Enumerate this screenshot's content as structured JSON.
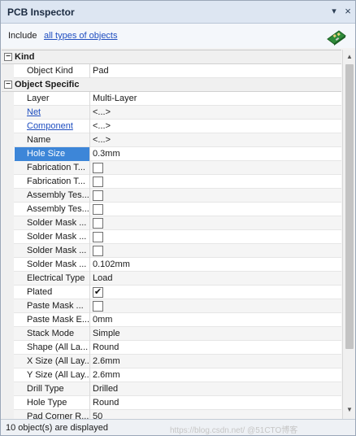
{
  "window": {
    "title": "PCB Inspector",
    "pin_glyph": "▾",
    "close_glyph": "×"
  },
  "include": {
    "label": "Include",
    "link": "all types of objects"
  },
  "categories": {
    "kind": {
      "toggle": "−",
      "label": "Kind"
    },
    "specific": {
      "toggle": "−",
      "label": "Object Specific"
    }
  },
  "properties": {
    "object_kind": {
      "name": "Object Kind",
      "value": "Pad"
    },
    "layer": {
      "name": "Layer",
      "value": "Multi-Layer"
    },
    "net": {
      "name": "Net",
      "value": "<...>"
    },
    "component": {
      "name": "Component",
      "value": "<...>"
    },
    "obj_name": {
      "name": "Name",
      "value": "<...>"
    },
    "hole_size": {
      "name": "Hole Size",
      "value": "0.3mm"
    },
    "fab_t1": {
      "name": "Fabrication T...",
      "checked": false
    },
    "fab_t2": {
      "name": "Fabrication T...",
      "checked": false
    },
    "asm_t1": {
      "name": "Assembly Tes...",
      "checked": false
    },
    "asm_t2": {
      "name": "Assembly Tes...",
      "checked": false
    },
    "sm1": {
      "name": "Solder Mask ...",
      "checked": false
    },
    "sm2": {
      "name": "Solder Mask ...",
      "checked": false
    },
    "sm3": {
      "name": "Solder Mask ...",
      "checked": false
    },
    "sm4": {
      "name": "Solder Mask ...",
      "value": "0.102mm"
    },
    "electrical_type": {
      "name": "Electrical Type",
      "value": "Load"
    },
    "plated": {
      "name": "Plated",
      "checked": true,
      "check_glyph": "✔"
    },
    "paste_mask1": {
      "name": "Paste Mask ...",
      "checked": false
    },
    "paste_mask2": {
      "name": "Paste Mask E...",
      "value": "0mm"
    },
    "stack_mode": {
      "name": "Stack Mode",
      "value": "Simple"
    },
    "shape": {
      "name": "Shape (All La...",
      "value": "Round"
    },
    "x_size": {
      "name": "X Size (All Lay...",
      "value": "2.6mm"
    },
    "y_size": {
      "name": "Y Size (All Lay...",
      "value": "2.6mm"
    },
    "drill_type": {
      "name": "Drill Type",
      "value": "Drilled"
    },
    "hole_type": {
      "name": "Hole Type",
      "value": "Round"
    },
    "pad_corner": {
      "name": "Pad Corner R...",
      "value": "50"
    }
  },
  "scrollbar": {
    "up_glyph": "▲",
    "down_glyph": "▼"
  },
  "status": {
    "text": "10 object(s) are displayed",
    "watermark": "https://blog.csdn.net/ @51CTO博客"
  },
  "icons": {
    "pin": "pin-dropdown-icon",
    "close": "close-icon",
    "pcb": "pcb-board-icon"
  },
  "colors": {
    "link": "#1f4ec0",
    "selection": "#3d86d8",
    "titlebar": "#dde6f2",
    "pcb_green": "#2e8b3a"
  }
}
